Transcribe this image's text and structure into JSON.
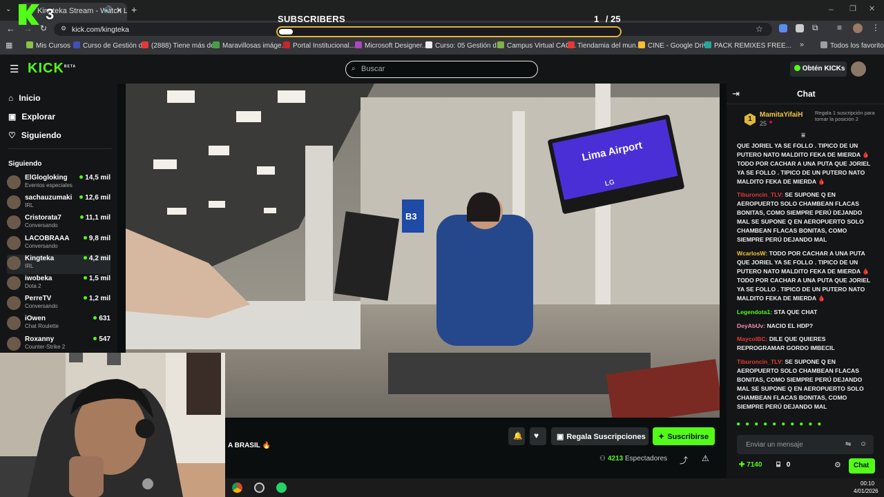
{
  "browser": {
    "tab_title": "Kingteka Stream - Watch L",
    "url": "kick.com/kingteka"
  },
  "bookmarks": [
    {
      "label": "Mis Cursos",
      "color": "#8bc34a"
    },
    {
      "label": "Curso de Gestión d...",
      "color": "#3f51b5"
    },
    {
      "label": "(2888) Tiene más de...",
      "color": "#e53935"
    },
    {
      "label": "Maravillosas imáge...",
      "color": "#43a047"
    },
    {
      "label": "Portal Institucional...",
      "color": "#c62828"
    },
    {
      "label": "Microsoft Designer...",
      "color": "#ab47bc"
    },
    {
      "label": "Curso: 05 Gestión d...",
      "color": "#eeeeee"
    },
    {
      "label": "Campus Virtual CAC...",
      "color": "#7cb342"
    },
    {
      "label": "Tiendamia del mun...",
      "color": "#e53935"
    },
    {
      "label": "CINE - Google Drive",
      "color": "#fbc02d"
    },
    {
      "label": "PACK REMIXES FREE...",
      "color": "#26a69a"
    },
    {
      "label": "Todos los favoritos",
      "color": "#9e9e9e"
    }
  ],
  "overlay": {
    "logo_badge": "3",
    "subscribers_label": "SUBSCRIBERS",
    "count": "1",
    "goal": "/ 25"
  },
  "kick": {
    "logo": "KICK",
    "logo_beta": "BETA",
    "search_placeholder": "Buscar",
    "get_kicks": "Obtén KICKs"
  },
  "nav": [
    {
      "label": "Inicio"
    },
    {
      "label": "Explorar"
    },
    {
      "label": "Siguiendo"
    }
  ],
  "following_title": "Siguiendo",
  "following": [
    {
      "name": "ElGlogloking",
      "category": "Eventos especiales",
      "viewers": "14,5 mil"
    },
    {
      "name": "sachauzumaki",
      "category": "IRL",
      "viewers": "12,6 mil"
    },
    {
      "name": "Cristorata7",
      "category": "Conversando",
      "viewers": "11,1 mil"
    },
    {
      "name": "LACOBRAAA",
      "category": "Conversando",
      "viewers": "9,8 mil"
    },
    {
      "name": "Kingteka",
      "category": "IRL",
      "viewers": "4,2 mil"
    },
    {
      "name": "iwobeka",
      "category": "Dota 2",
      "viewers": "1,5 mil"
    },
    {
      "name": "PerreTV",
      "category": "Conversando",
      "viewers": "1,2 mil"
    },
    {
      "name": "iOwen",
      "category": "Chat Roulette",
      "viewers": "631"
    },
    {
      "name": "Roxanny",
      "category": "Counter-Strike 2",
      "viewers": "547"
    }
  ],
  "video": {
    "sign_brand": "Lima Airport",
    "gate": "B3",
    "tv_brand": "LG"
  },
  "stream": {
    "title": "A BRASIL 🔥",
    "gift_subs": "Regala Suscripciones",
    "subscribe": "Suscribirse",
    "viewers": "4213",
    "viewers_label": "Espectadores"
  },
  "chat": {
    "title": "Chat",
    "pinned_user": "MamitaYifaiH",
    "pinned_rank": "1",
    "pinned_count": "25",
    "pinned_note": "Regala 1 suscripción para tomar la posición 2",
    "messages": [
      {
        "user": "",
        "color": "#ffffff",
        "text": "QUE JORIEL YA SE FOLLO . TIPICO DE UN PUTERO NATO MALDITO FEKA DE MIERDA 🩸 TODO POR CACHAR A UNA PUTA QUE JORIEL YA SE FOLLO . TIPICO DE UN PUTERO NATO MALDITO FEKA DE MIERDA 🩸"
      },
      {
        "user": "Tiburoncin_TLV:",
        "color": "#e53935",
        "text": "SE SUPONE Q EN AEROPUERTO SOLO CHAMBEAN FLACAS BONITAS, COMO SIEMPRE PERÚ DEJANDO MAL SE SUPONE Q EN AEROPUERTO SOLO CHAMBEAN FLACAS BONITAS, COMO SIEMPRE PERÚ DEJANDO MAL"
      },
      {
        "user": "WcarlosW:",
        "color": "#f5c542",
        "text": "TODO POR CACHAR A UNA PUTA QUE JORIEL YA SE FOLLO . TIPICO DE UN PUTERO NATO MALDITO FEKA DE MIERDA 🩸 TODO POR CACHAR A UNA PUTA QUE JORIEL YA SE FOLLO . TIPICO DE UN PUTERO NATO MALDITO FEKA DE MIERDA 🩸"
      },
      {
        "user": "Legendota1:",
        "color": "#53fc18",
        "text": "STA QUE CHAT"
      },
      {
        "user": "DeyAbUv:",
        "color": "#f48fb1",
        "text": "NACIO EL HDP?"
      },
      {
        "user": "MaycolBC:",
        "color": "#e53935",
        "text": "DILE QUE QUIERES REPROGRAMAR GORDO IMBECIL"
      },
      {
        "user": "Tiburoncin_TLV:",
        "color": "#e53935",
        "text": "SE SUPONE Q EN AEROPUERTO SOLO CHAMBEAN FLACAS BONITAS, COMO SIEMPRE PERÚ DEJANDO MAL SE SUPONE Q EN AEROPUERTO SOLO CHAMBEAN FLACAS BONITAS, COMO SIEMPRE PERÚ DEJANDO MAL"
      }
    ],
    "input_placeholder": "Enviar un mensaje",
    "kicks": "7140",
    "gifts": "0",
    "send": "Chat"
  },
  "taskbar": {
    "time": "00:10",
    "date": "4/01/2026"
  }
}
